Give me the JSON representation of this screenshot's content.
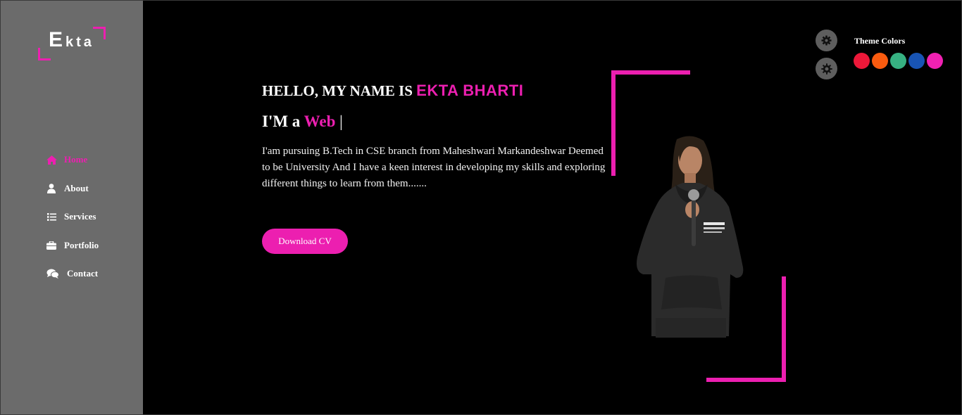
{
  "logo": {
    "big": "E",
    "small": "kta"
  },
  "nav": [
    {
      "label": "Home",
      "icon": "home-icon",
      "active": true
    },
    {
      "label": "About",
      "icon": "user-icon",
      "active": false
    },
    {
      "label": "Services",
      "icon": "list-icon",
      "active": false
    },
    {
      "label": "Portfolio",
      "icon": "briefcase-icon",
      "active": false
    },
    {
      "label": "Contact",
      "icon": "comments-icon",
      "active": false
    }
  ],
  "hero": {
    "greeting": "HELLO, MY NAME IS",
    "name": "EKTA BHARTI",
    "role_prefix": "I'M a",
    "role_word": "Web",
    "caret": "|",
    "description": "I'am pursuing B.Tech in CSE branch from Maheshwari Markandeshwar Deemed to be University And I have a keen interest in developing my skills and exploring different things to learn from them.......",
    "cv_button": "Download CV"
  },
  "theme": {
    "label": "Theme Colors",
    "colors": [
      "#ec1839",
      "#fa5b0f",
      "#37b182",
      "#1854b4",
      "#f021b2"
    ]
  },
  "accent_color": "#ec1fb0"
}
